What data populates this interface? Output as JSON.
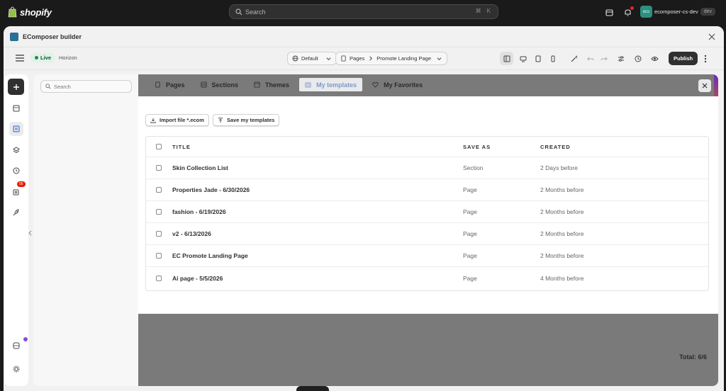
{
  "shopify": {
    "logo": "shopify",
    "search_placeholder": "Search",
    "shortcut_cmd": "⌘",
    "shortcut_key": "K",
    "notification_count": "1",
    "account_initials": "ecs",
    "account_name": "ecomposer-cs-dev",
    "account_tag": "dev"
  },
  "window": {
    "title": "EComposer builder"
  },
  "toolbar": {
    "status": "Live",
    "theme_name": "Horizon",
    "template_select": "Default",
    "page_type": "Pages",
    "page_name": "Promote Landing Page",
    "publish_label": "Publish"
  },
  "rail": {
    "badge": "56"
  },
  "sidepanel": {
    "search_placeholder": "Search"
  },
  "modal": {
    "tabs": [
      {
        "label": "Pages",
        "icon": "page-icon"
      },
      {
        "label": "Sections",
        "icon": "section-icon"
      },
      {
        "label": "Themes",
        "icon": "theme-icon"
      },
      {
        "label": "My templates",
        "icon": "folder-icon",
        "active": true
      },
      {
        "label": "My Favorites",
        "icon": "heart-icon"
      }
    ],
    "import_label": "Import file *.ecom",
    "save_label": "Save my templates",
    "table": {
      "headers": {
        "title": "TITLE",
        "save_as": "SAVE AS",
        "created": "CREATED"
      },
      "rows": [
        {
          "title": "Skin Collection List",
          "save_as": "Section",
          "created": "2 Days before"
        },
        {
          "title": "Properties Jade - 6/30/2026",
          "save_as": "Page",
          "created": "2 Months before"
        },
        {
          "title": "fashion - 6/19/2026",
          "save_as": "Page",
          "created": "2 Months before"
        },
        {
          "title": "v2 - 6/13/2026",
          "save_as": "Page",
          "created": "2 Months before"
        },
        {
          "title": "EC Promote Landing Page",
          "save_as": "Page",
          "created": "2 Months before"
        },
        {
          "title": "Ai page - 5/5/2026",
          "save_as": "Page",
          "created": "4 Months before"
        }
      ]
    },
    "total": "Total: 6/6"
  },
  "colors": {
    "active_tab_text": "#7f99c8",
    "publish_bg": "#303030",
    "live_dot": "#29845a",
    "badge_red": "#e51c00"
  }
}
